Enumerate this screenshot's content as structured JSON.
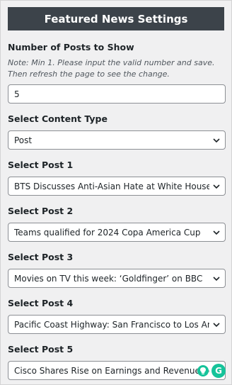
{
  "header": {
    "title": "Featured News Settings"
  },
  "posts_count": {
    "label": "Number of Posts to Show",
    "note": "Note: Min 1. Please input the valid number and save. Then refresh the page to see the change.",
    "value": "5"
  },
  "content_type": {
    "label": "Select Content Type",
    "selected": "Post"
  },
  "posts": [
    {
      "label": "Select Post 1",
      "selected": "BTS Discusses Anti-Asian Hate at White House"
    },
    {
      "label": "Select Post 2",
      "selected": "Teams qualified for 2024 Copa America Cup"
    },
    {
      "label": "Select Post 3",
      "selected": "Movies on TV this week: ‘Goldfinger’ on BBC"
    },
    {
      "label": "Select Post 4",
      "selected": "Pacific Coast Highway: San Francisco to Los Angeles"
    },
    {
      "label": "Select Post 5",
      "selected": "Cisco Shares Rise on Earnings and Revenue Beat"
    }
  ],
  "icons": {
    "chevron": "chevron-down-icon",
    "grammarly_bulb": "lightbulb-icon",
    "grammarly_logo": "grammarly-icon"
  },
  "grammarly": {
    "logo_letter": "G"
  },
  "colors": {
    "header_bg": "#3c434a",
    "page_bg": "#f0f0f1",
    "grammarly": "#15c39a"
  }
}
